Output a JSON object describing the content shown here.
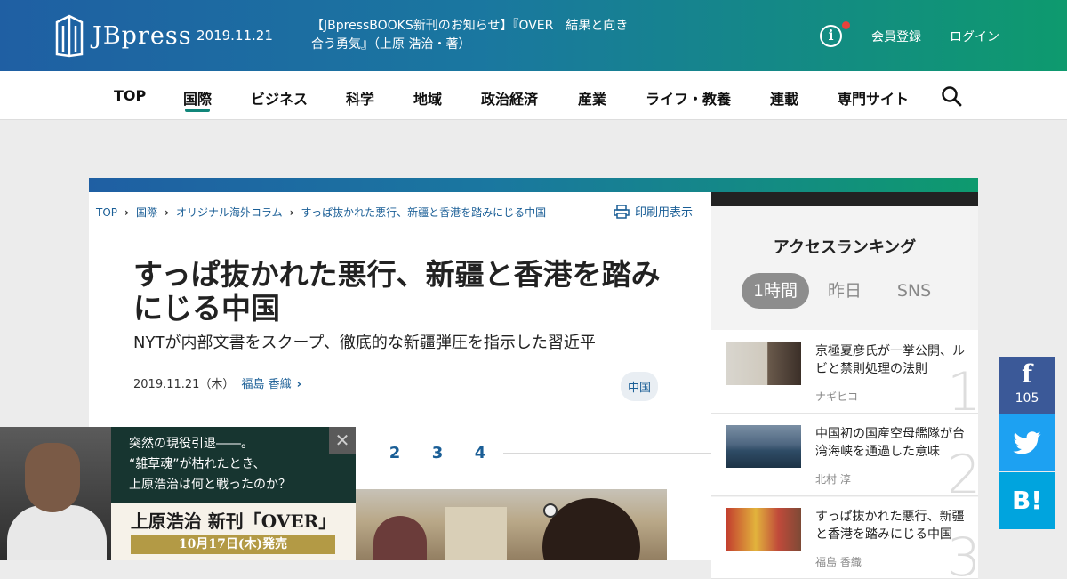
{
  "header": {
    "logo_text": "JBpress",
    "date": "2019.11.21",
    "notice": "【JBpressBOOKS新刊のお知らせ】『OVER　結果と向き合う勇気』（上原 浩治・著）",
    "register": "会員登録",
    "login": "ログイン"
  },
  "nav": {
    "items": [
      "TOP",
      "国際",
      "ビジネス",
      "科学",
      "地域",
      "政治経済",
      "産業",
      "ライフ・教養",
      "連載",
      "専門サイト"
    ],
    "active": "国際"
  },
  "breadcrumb": [
    "TOP",
    "国際",
    "オリジナル海外コラム",
    "すっぱ抜かれた悪行、新疆と香港を踏みにじる中国"
  ],
  "print_label": "印刷用表示",
  "article": {
    "title": "すっぱ抜かれた悪行、新疆と香港を踏みにじる中国",
    "subtitle": "NYTが内部文書をスクープ、徹底的な新疆弾圧を指示した習近平",
    "date": "2019.11.21（木）",
    "author": "福島 香織",
    "tag": "中国",
    "pages": [
      "2",
      "3",
      "4"
    ]
  },
  "ranking": {
    "title": "アクセスランキング",
    "tabs": [
      "1時間",
      "昨日",
      "SNS"
    ],
    "active_tab": "1時間",
    "items": [
      {
        "rank": "1",
        "text": "京極夏彦氏が一挙公開、ルビと禁則処理の法則",
        "author": "ナギヒコ"
      },
      {
        "rank": "2",
        "text": "中国初の国産空母艦隊が台湾海峡を通過した意味",
        "author": "北村 淳"
      },
      {
        "rank": "3",
        "text": "すっぱ抜かれた悪行、新疆と香港を踏みにじる中国",
        "author": "福島 香織"
      }
    ]
  },
  "social": {
    "facebook_count": "105",
    "hatena_label": "B!",
    "facebook_icon": "f"
  },
  "ad": {
    "text": "突然の現役引退――。\n“雑草魂”が枯れたとき、\n上原浩治は何と戦ったのか？",
    "book_title": "上原浩治 新刊「OVER」",
    "release": "10月17日(木)発売",
    "close": "✕"
  },
  "colors": {
    "accent": "#11867a",
    "link": "#1a5e96",
    "facebook": "#3b5998",
    "twitter": "#1da1f2",
    "hatena": "#00a4de"
  }
}
